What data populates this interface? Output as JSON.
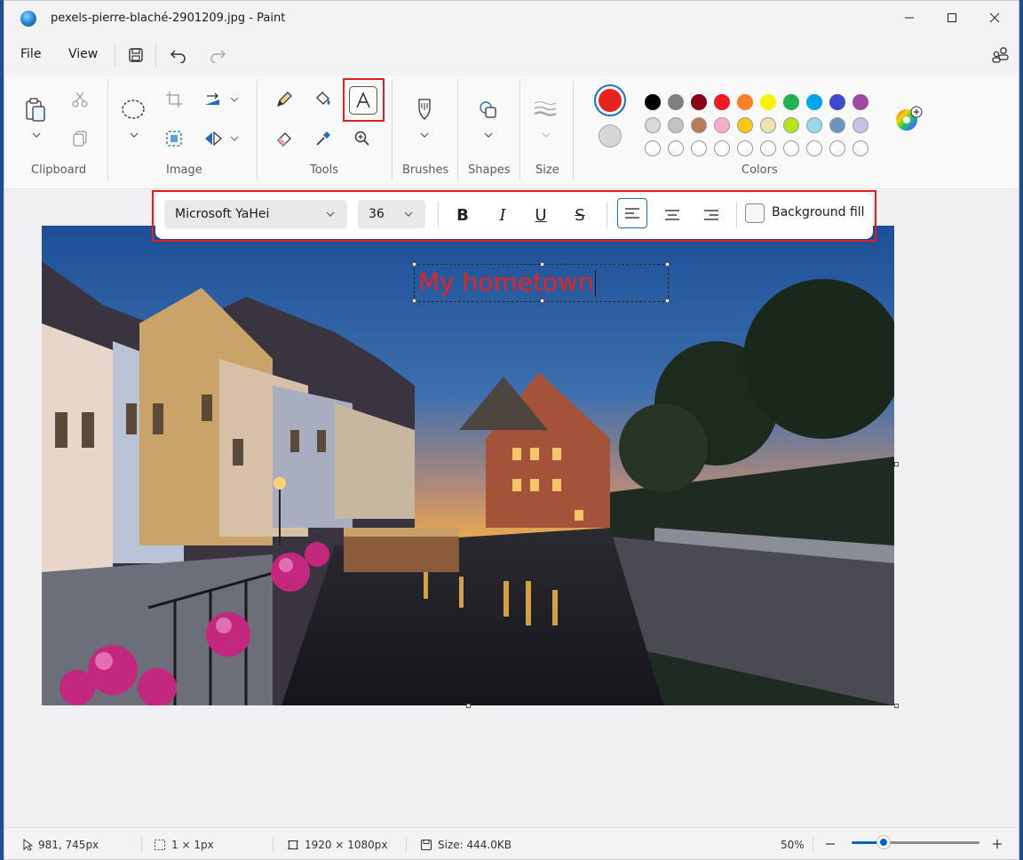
{
  "window": {
    "title": "pexels-pierre-blaché-2901209.jpg - Paint"
  },
  "menu": {
    "file": "File",
    "view": "View"
  },
  "ribbon": {
    "groups": {
      "clipboard": "Clipboard",
      "image": "Image",
      "tools": "Tools",
      "brushes": "Brushes",
      "shapes": "Shapes",
      "size": "Size",
      "colors": "Colors"
    },
    "primary_color": "#e8231f",
    "secondary_color": "#d6d6d6",
    "palette_row1": [
      "#000000",
      "#7f7f7f",
      "#880015",
      "#ed1c24",
      "#ff7f27",
      "#fff200",
      "#22b14c",
      "#00a2e8",
      "#3f48cc",
      "#a349a4"
    ],
    "palette_row2": [
      "#d9d9d9",
      "#c3c3c3",
      "#b97a57",
      "#ffaec9",
      "#ffc90e",
      "#efe4b0",
      "#b5e61d",
      "#99d9ea",
      "#7092be",
      "#c8bfe7"
    ],
    "palette_row3_count_label": ""
  },
  "text_toolbar": {
    "font_name": "Microsoft YaHei",
    "font_size": "36",
    "bold": "B",
    "italic": "I",
    "underline": "U",
    "strikethrough": "S",
    "background_fill_label": "Background fill",
    "background_fill_checked": false
  },
  "canvas": {
    "text_value": "My hometown",
    "text_color": "#e8231f"
  },
  "status": {
    "cursor_pos": "981, 745px",
    "selection_size": "1 × 1px",
    "image_size": "1920 × 1080px",
    "file_size": "Size: 444.0KB",
    "zoom": "50%",
    "zoom_level": 0.25
  }
}
